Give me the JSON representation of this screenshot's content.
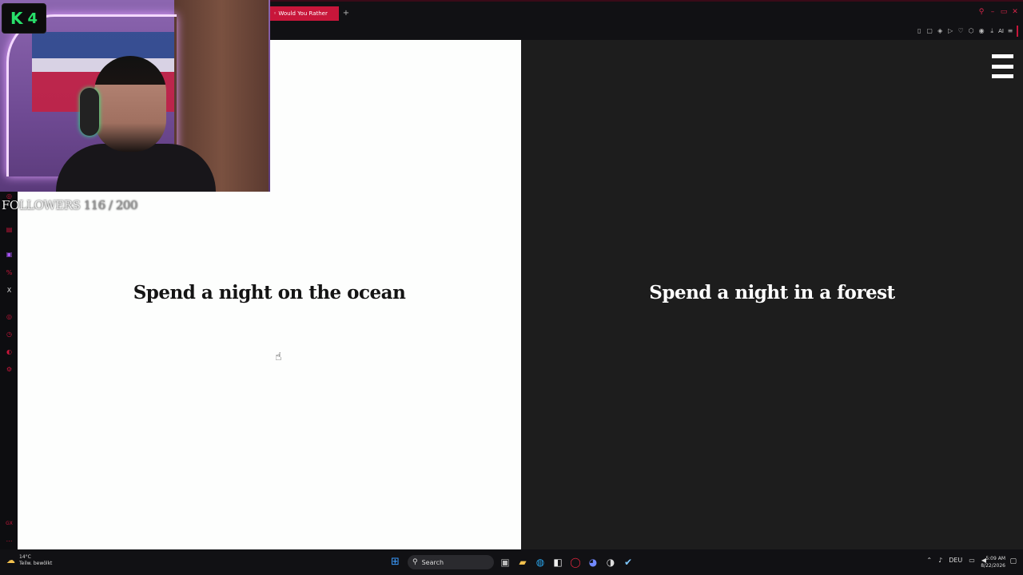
{
  "browser": {
    "tab_title": "◦ Would You Rather",
    "new_tab": "+",
    "window_controls": {
      "search": "⚲",
      "minimize": "–",
      "restore": "▭",
      "close": "✕"
    },
    "toolbar_ai": "AI"
  },
  "game": {
    "option_left": "Spend a night on the ocean",
    "option_right": "Spend a night in a forest"
  },
  "overlay": {
    "badge_letter": "K",
    "badge_number": "4",
    "followers_label": "FOLLOWERS ",
    "followers_count": "116 / 200"
  },
  "taskbar": {
    "weather_temp": "14°C",
    "weather_desc": "Teilw. bewölkt",
    "search_placeholder": "Search",
    "language": "DEU",
    "time": "5:09 AM",
    "date": "8/22/2026"
  },
  "colors": {
    "accent": "#c8163a",
    "left_panel": "#fdfefd",
    "right_panel": "#1d1d1d",
    "badge_green": "#28e06a"
  }
}
